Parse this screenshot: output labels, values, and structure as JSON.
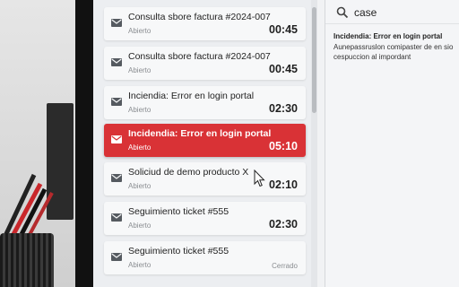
{
  "tickets": [
    {
      "title": "Consulta sbore factura #2024-007",
      "status": "Abierto",
      "time": "00:45",
      "active": false,
      "time_style": "bold"
    },
    {
      "title": "Consulta sbore factura #2024-007",
      "status": "Abierto",
      "time": "00:45",
      "active": false,
      "time_style": "bold"
    },
    {
      "title": "Inciendia: Error en login portal",
      "status": "Abierto",
      "time": "02:30",
      "active": false,
      "time_style": "bold"
    },
    {
      "title": "Incidendia: Error en login portal",
      "status": "Abierto",
      "time": "05:10",
      "active": true,
      "time_style": "bold"
    },
    {
      "title": "Soliciud de demo producto X",
      "status": "Abierto",
      "time": "02:10",
      "active": false,
      "time_style": "bold"
    },
    {
      "title": "Seguimiento ticket #555",
      "status": "Abierto",
      "time": "02:30",
      "active": false,
      "time_style": "bold"
    },
    {
      "title": "Seguimiento ticket #555",
      "status": "Abierto",
      "time": "Cerrado",
      "active": false,
      "time_style": "small"
    }
  ],
  "search": {
    "value": "case",
    "icon": "search-icon"
  },
  "result": {
    "title": "Incidendia: Error en login portal",
    "text": "Aunepassruslon comipaster de en sio cespuccion al impordant"
  },
  "colors": {
    "accent": "#d93236",
    "card_bg": "#f7f8f9",
    "list_bg": "#eceef1"
  },
  "icons": {
    "ticket": "mail-icon",
    "pointer": "mouse-cursor-icon"
  }
}
